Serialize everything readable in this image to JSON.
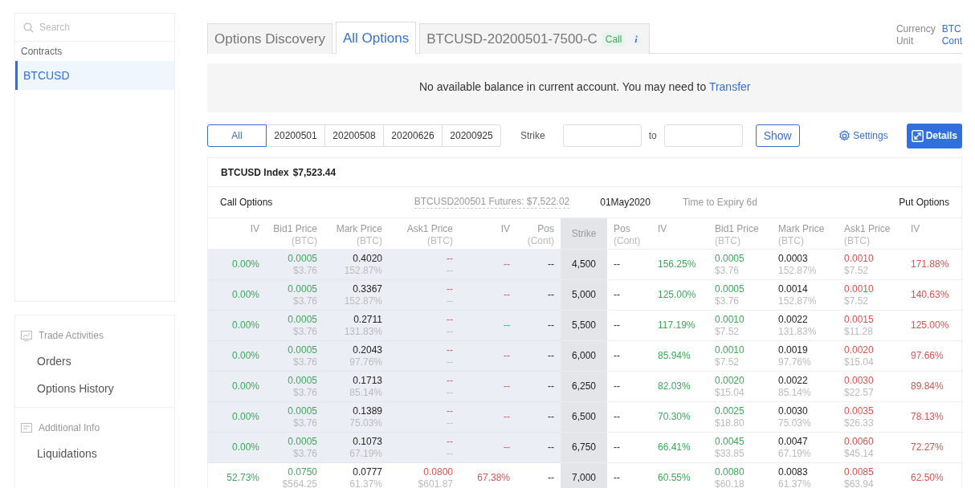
{
  "sidebar": {
    "search": {
      "placeholder": "Search"
    },
    "contracts_header": "Contracts",
    "contracts": [
      {
        "label": "BTCUSD",
        "selected": true
      }
    ],
    "sections": [
      {
        "kind": "chart",
        "title": "Trade Activities",
        "items": [
          "Orders",
          "Options History"
        ]
      },
      {
        "kind": "doc",
        "title": "Additional Info",
        "items": [
          "Liquidations"
        ]
      }
    ]
  },
  "tabs": [
    {
      "label": "Options Discovery",
      "selected": false
    },
    {
      "label": "All Options",
      "selected": true
    },
    {
      "label": "BTCUSD-20200501-7500-C",
      "selected": false,
      "badge": "Call",
      "info": true
    }
  ],
  "currency": {
    "label": "Currency",
    "value": "BTC"
  },
  "unit": {
    "label": "Unit",
    "value": "Cont"
  },
  "assets": {
    "notice": "No available balance in current account. You may need to",
    "notice_link": "Transfer"
  },
  "expiries": [
    {
      "label": "All",
      "selected": true
    },
    {
      "label": "20200501",
      "selected": false
    },
    {
      "label": "20200508",
      "selected": false
    },
    {
      "label": "20200626",
      "selected": false
    },
    {
      "label": "20200925",
      "selected": false
    }
  ],
  "strike_filter": {
    "label": "Strike",
    "to": "to",
    "button": "Show"
  },
  "settings": "Settings",
  "details": "Details",
  "index": {
    "label": "BTCUSD Index",
    "value": "$7,523.44"
  },
  "info_row": {
    "call": "Call Options",
    "futures": "BTCUSD200501 Futures: $7,522.02",
    "date": "01May2020",
    "expiry": "Time to Expiry 6d",
    "put": "Put Options"
  },
  "columns": [
    {
      "label": "IV"
    },
    {
      "label": "Bid1 Price",
      "sub": "(BTC)"
    },
    {
      "label": "Mark Price",
      "sub": "(BTC)"
    },
    {
      "label": "Ask1 Price",
      "sub": "(BTC)"
    },
    {
      "label": "IV"
    },
    {
      "label": "Pos",
      "sub": "(Cont)"
    },
    {
      "label": "Strike"
    },
    {
      "label": "Pos",
      "sub": "(Cont)"
    },
    {
      "label": "IV"
    },
    {
      "label": "Bid1 Price",
      "sub": "(BTC)"
    },
    {
      "label": "Mark Price",
      "sub": "(BTC)"
    },
    {
      "label": "Ask1 Price",
      "sub": "(BTC)"
    },
    {
      "label": "IV"
    }
  ],
  "rows": [
    {
      "strike": "4,500",
      "itm": true,
      "call": [
        "0.00%",
        [
          "0.0005",
          "$3.76"
        ],
        [
          "0.4020",
          "152.87%"
        ],
        [
          "--",
          "--"
        ],
        "--",
        "--"
      ],
      "put": [
        "--",
        "156.25%",
        [
          "0.0005",
          "$3.76"
        ],
        [
          "0.0003",
          "152.87%"
        ],
        [
          "0.0010",
          "$7.52"
        ],
        "171.88%"
      ]
    },
    {
      "strike": "5,000",
      "itm": true,
      "call": [
        "0.00%",
        [
          "0.0005",
          "$3.76"
        ],
        [
          "0.3367",
          "152.87%"
        ],
        [
          "--",
          "--"
        ],
        "--",
        "--"
      ],
      "put": [
        "--",
        "125.00%",
        [
          "0.0005",
          "$3.76"
        ],
        [
          "0.0014",
          "152.87%"
        ],
        [
          "0.0010",
          "$7.52"
        ],
        "140.63%"
      ]
    },
    {
      "strike": "5,500",
      "itm": true,
      "call": [
        "0.00%",
        [
          "0.0005",
          "$3.76"
        ],
        [
          "0.2711",
          "131.83%"
        ],
        [
          "--",
          "--"
        ],
        "--",
        "--"
      ],
      "put": [
        "--",
        "117.19%",
        [
          "0.0010",
          "$7.52"
        ],
        [
          "0.0022",
          "131.83%"
        ],
        [
          "0.0015",
          "$11.28"
        ],
        "125.00%"
      ]
    },
    {
      "strike": "6,000",
      "itm": true,
      "call": [
        "0.00%",
        [
          "0.0005",
          "$3.76"
        ],
        [
          "0.2043",
          "97.76%"
        ],
        [
          "--",
          "--"
        ],
        "--",
        "--"
      ],
      "put": [
        "--",
        "85.94%",
        [
          "0.0010",
          "$7.52"
        ],
        [
          "0.0019",
          "97.76%"
        ],
        [
          "0.0020",
          "$15.04"
        ],
        "97.66%"
      ]
    },
    {
      "strike": "6,250",
      "itm": true,
      "call": [
        "0.00%",
        [
          "0.0005",
          "$3.76"
        ],
        [
          "0.1713",
          "85.14%"
        ],
        [
          "--",
          "--"
        ],
        "--",
        "--"
      ],
      "put": [
        "--",
        "82.03%",
        [
          "0.0020",
          "$15.04"
        ],
        [
          "0.0022",
          "85.14%"
        ],
        [
          "0.0030",
          "$22.57"
        ],
        "89.84%"
      ]
    },
    {
      "strike": "6,500",
      "itm": true,
      "call": [
        "0.00%",
        [
          "0.0005",
          "$3.76"
        ],
        [
          "0.1389",
          "75.03%"
        ],
        [
          "--",
          "--"
        ],
        "--",
        "--"
      ],
      "put": [
        "--",
        "70.30%",
        [
          "0.0025",
          "$18.80"
        ],
        [
          "0.0030",
          "75.03%"
        ],
        [
          "0.0035",
          "$26.33"
        ],
        "78.13%"
      ]
    },
    {
      "strike": "6,750",
      "itm": true,
      "call": [
        "0.00%",
        [
          "0.0005",
          "$3.76"
        ],
        [
          "0.1073",
          "67.19%"
        ],
        [
          "--",
          "--"
        ],
        "--",
        "--"
      ],
      "put": [
        "--",
        "66.41%",
        [
          "0.0045",
          "$33.85"
        ],
        [
          "0.0047",
          "67.19%"
        ],
        [
          "0.0060",
          "$45.14"
        ],
        "72.27%"
      ]
    },
    {
      "strike": "7,000",
      "itm": false,
      "call": [
        "52.73%",
        [
          "0.0750",
          "$564.25"
        ],
        [
          "0.0777",
          "61.37%"
        ],
        [
          "0.0800",
          "$601.87"
        ],
        "67.38%",
        "--"
      ],
      "put": [
        "--",
        "60.55%",
        [
          "0.0080",
          "$60.18"
        ],
        [
          "0.0083",
          "61.37%"
        ],
        [
          "0.0085",
          "$63.94"
        ],
        "62.50%"
      ]
    }
  ]
}
